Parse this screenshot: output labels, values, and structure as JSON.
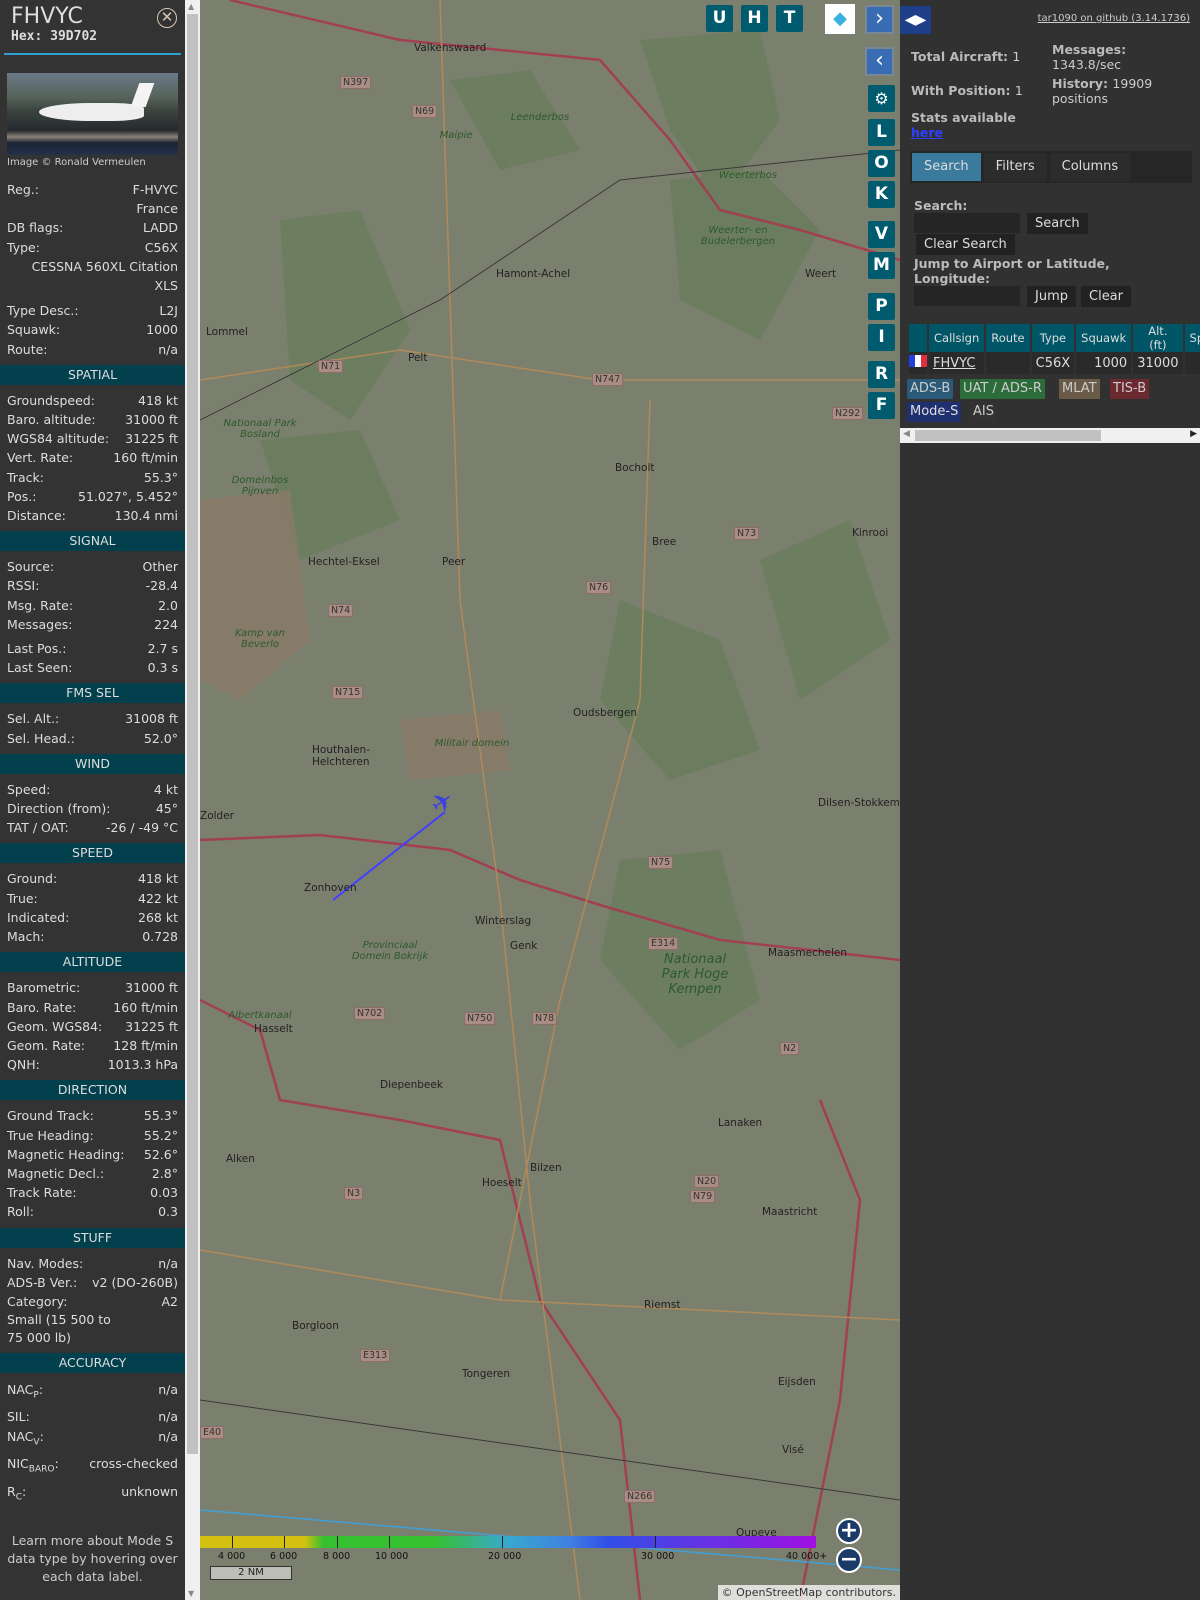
{
  "sidebar": {
    "callsign": "FHVYC",
    "hex": "Hex: 39D702",
    "close_icon": "close-circle-icon",
    "photo_credit": "Image © Ronald Vermeulen",
    "info": {
      "reg_label": "Reg.:",
      "reg": "F-HVYC",
      "country": "France",
      "dbflags_label": "DB flags:",
      "dbflags": "LADD",
      "type_label": "Type:",
      "type": "C56X",
      "type_full": "CESSNA 560XL Citation XLS",
      "typedesc_label": "Type Desc.:",
      "typedesc": "L2J",
      "squawk_label": "Squawk:",
      "squawk": "1000",
      "route_label": "Route:",
      "route": "n/a"
    },
    "sections": [
      {
        "title": "SPATIAL",
        "rows": [
          [
            "Groundspeed:",
            "418 kt"
          ],
          [
            "Baro. altitude:",
            "31000 ft"
          ],
          [
            "WGS84 altitude:",
            "31225 ft"
          ],
          [
            "Vert. Rate:",
            "160 ft/min"
          ],
          [
            "Track:",
            "55.3°"
          ],
          [
            "Pos.:",
            "51.027°, 5.452°"
          ],
          [
            "Distance:",
            "130.4 nmi"
          ]
        ]
      },
      {
        "title": "SIGNAL",
        "rows": [
          [
            "Source:",
            "Other"
          ],
          [
            "RSSI:",
            "-28.4"
          ],
          [
            "Msg. Rate:",
            "2.0"
          ],
          [
            "Messages:",
            "224"
          ],
          [
            "Last Pos.:",
            "2.7 s"
          ],
          [
            "Last Seen:",
            "0.3 s"
          ]
        ]
      },
      {
        "title": "FMS SEL",
        "rows": [
          [
            "Sel. Alt.:",
            "31008 ft"
          ],
          [
            "Sel. Head.:",
            "52.0°"
          ]
        ]
      },
      {
        "title": "WIND",
        "rows": [
          [
            "Speed:",
            "4 kt"
          ],
          [
            "Direction (from):",
            "45°"
          ],
          [
            "TAT / OAT:",
            "-26 / -49 °C"
          ]
        ]
      },
      {
        "title": "SPEED",
        "rows": [
          [
            "Ground:",
            "418 kt"
          ],
          [
            "True:",
            "422 kt"
          ],
          [
            "Indicated:",
            "268 kt"
          ],
          [
            "Mach:",
            "0.728"
          ]
        ]
      },
      {
        "title": "ALTITUDE",
        "rows": [
          [
            "Barometric:",
            "31000 ft"
          ],
          [
            "Baro. Rate:",
            "160 ft/min"
          ],
          [
            "Geom. WGS84:",
            "31225 ft"
          ],
          [
            "Geom. Rate:",
            "128 ft/min"
          ],
          [
            "QNH:",
            "1013.3 hPa"
          ]
        ]
      },
      {
        "title": "DIRECTION",
        "rows": [
          [
            "Ground Track:",
            "55.3°"
          ],
          [
            "True Heading:",
            "55.2°"
          ],
          [
            "Magnetic Heading:",
            "52.6°"
          ],
          [
            "Magnetic Decl.:",
            "2.8°"
          ],
          [
            "Track Rate:",
            "0.03"
          ],
          [
            "Roll:",
            "0.3"
          ]
        ]
      },
      {
        "title": "STUFF",
        "rows": [
          [
            "Nav. Modes:",
            "n/a"
          ],
          [
            "ADS-B Ver.:",
            "v2 (DO-260B)"
          ],
          [
            "Category:",
            "A2"
          ]
        ],
        "extra": "Small (15 500 to 75 000 lb)"
      }
    ],
    "accuracy": {
      "title": "ACCURACY",
      "nacp": "NAC",
      "nacp_sub": "P",
      "nacp_v": "n/a",
      "sil": "SIL:",
      "sil_v": "n/a",
      "nacv": "NAC",
      "nacv_sub": "V",
      "nacv_v": "n/a",
      "nic": "NIC",
      "nic_sub": "BARO",
      "nic_v": "cross-checked",
      "rc": "R",
      "rc_sub": "C",
      "rc_v": "unknown"
    },
    "note": "Learn more about Mode S data type by hovering over each data label."
  },
  "map": {
    "top_buttons": [
      "U",
      "H",
      "T"
    ],
    "side_buttons": [
      "L",
      "O",
      "K",
      "V",
      "M",
      "P",
      "I",
      "R",
      "F"
    ],
    "places": [
      "Valkenswaard",
      "Hamont-Achel",
      "Weert",
      "Lommel",
      "Pelt",
      "Bocholt",
      "Bree",
      "Kinrooi",
      "Hechtel-Eksel",
      "Peer",
      "Oudsbergen",
      "Houthalen-Helchteren",
      "Zolder",
      "Zonhoven",
      "Winterslag",
      "Genk",
      "Dilsen-Stokkem",
      "Maasmechelen",
      "Hasselt",
      "Diepenbeek",
      "Lanaken",
      "Alken",
      "Bilzen",
      "Hoeselt",
      "Maastricht",
      "Borgloon",
      "Riemst",
      "Tongeren",
      "Eijsden",
      "Visé",
      "Oupeye"
    ],
    "nature": [
      "Leenderbos",
      "Maipie",
      "Weerterbos",
      "Weerter- en Budelerbergen",
      "Nationaal Park Bosland",
      "Domeinbos Pijnven",
      "Kamp van Beverlo",
      "Militair domein",
      "Provinciaal Domein Bokrijk",
      "Nationaal Park Hoge Kempen",
      "Albertkanaal"
    ],
    "roads": [
      "N397",
      "N69",
      "N71",
      "N747",
      "N292",
      "N73",
      "N76",
      "N74",
      "N715",
      "N75",
      "E314",
      "N702",
      "N750",
      "N78",
      "N2",
      "N20",
      "N79",
      "N3",
      "E313",
      "E40",
      "N266"
    ],
    "legend": {
      "ticks": [
        "4 000",
        "6 000",
        "8 000",
        "10 000",
        "20 000",
        "30 000",
        "40 000+"
      ]
    },
    "scale": "2 NM",
    "attribution_prefix": "©",
    "attribution_link": "OpenStreetMap",
    "attribution_suffix": "contributors.",
    "zoom_in": "+",
    "zoom_out": "−"
  },
  "right": {
    "github": "tar1090 on github (3.14.1736)",
    "total_label": "Total Aircraft:",
    "total": "1",
    "withpos_label": "With Position:",
    "withpos": "1",
    "stats_label": "Stats available",
    "stats_link": "here",
    "messages_label": "Messages:",
    "messages": "1343.8/sec",
    "history_label": "History:",
    "history": "19909 positions",
    "tabs": [
      "Search",
      "Filters",
      "Columns"
    ],
    "search_label": "Search:",
    "search_btn": "Search",
    "clear_search": "Clear Search",
    "jump_label": "Jump to Airport or Latitude, Longitude:",
    "jump_btn": "Jump",
    "clear_btn": "Clear",
    "columns": [
      "",
      "Callsign",
      "Route",
      "Type",
      "Squawk",
      "Alt. (ft)",
      "Spd."
    ],
    "row": {
      "callsign": "FHVYC",
      "route": "",
      "type": "C56X",
      "squawk": "1000",
      "alt": "31000",
      "spd": ""
    },
    "sources": [
      {
        "label": "ADS-B",
        "color": "#2a5a78"
      },
      {
        "label": "UAT / ADS-R",
        "color": "#2c6b3a"
      },
      {
        "label": "MLAT",
        "color": "#6a5a48"
      },
      {
        "label": "TIS-B",
        "color": "#6a2a30"
      },
      {
        "label": "Mode-S",
        "color": "#1f3070"
      },
      {
        "label": "AIS",
        "color": "#333333"
      }
    ]
  }
}
